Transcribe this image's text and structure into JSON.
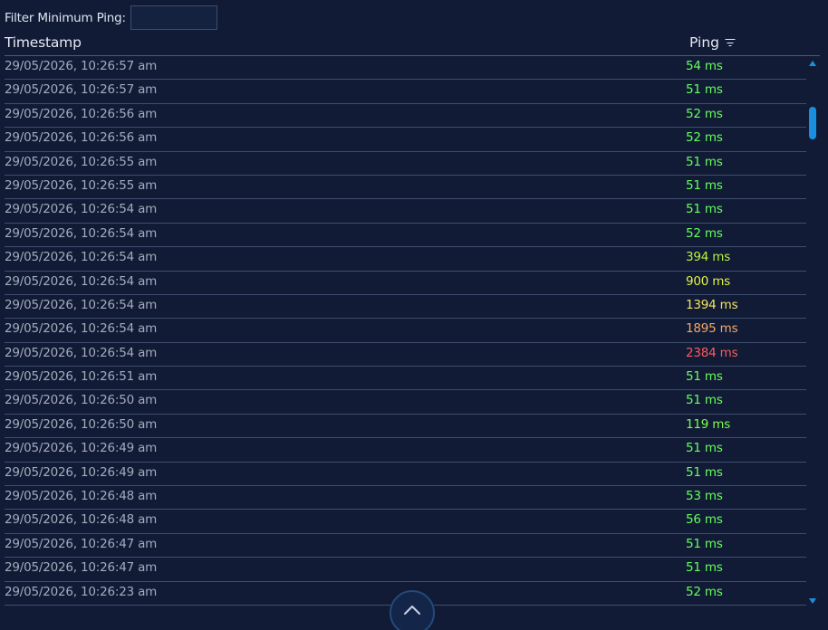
{
  "filter": {
    "label": "Filter Minimum Ping:",
    "value": "",
    "placeholder": ""
  },
  "table": {
    "columns": {
      "timestamp": "Timestamp",
      "ping": "Ping"
    },
    "rows": [
      {
        "timestamp": "29/05/2026, 10:26:57 am",
        "ping": "54 ms",
        "color": "#66ff5c"
      },
      {
        "timestamp": "29/05/2026, 10:26:57 am",
        "ping": "51 ms",
        "color": "#66ff5c"
      },
      {
        "timestamp": "29/05/2026, 10:26:56 am",
        "ping": "52 ms",
        "color": "#66ff5c"
      },
      {
        "timestamp": "29/05/2026, 10:26:56 am",
        "ping": "52 ms",
        "color": "#66ff5c"
      },
      {
        "timestamp": "29/05/2026, 10:26:55 am",
        "ping": "51 ms",
        "color": "#66ff5c"
      },
      {
        "timestamp": "29/05/2026, 10:26:55 am",
        "ping": "51 ms",
        "color": "#66ff5c"
      },
      {
        "timestamp": "29/05/2026, 10:26:54 am",
        "ping": "51 ms",
        "color": "#66ff5c"
      },
      {
        "timestamp": "29/05/2026, 10:26:54 am",
        "ping": "52 ms",
        "color": "#66ff5c"
      },
      {
        "timestamp": "29/05/2026, 10:26:54 am",
        "ping": "394 ms",
        "color": "#b6f53f"
      },
      {
        "timestamp": "29/05/2026, 10:26:54 am",
        "ping": "900 ms",
        "color": "#e3f249"
      },
      {
        "timestamp": "29/05/2026, 10:26:54 am",
        "ping": "1394 ms",
        "color": "#f5e45a"
      },
      {
        "timestamp": "29/05/2026, 10:26:54 am",
        "ping": "1895 ms",
        "color": "#f7a868"
      },
      {
        "timestamp": "29/05/2026, 10:26:54 am",
        "ping": "2384 ms",
        "color": "#ff5a5a"
      },
      {
        "timestamp": "29/05/2026, 10:26:51 am",
        "ping": "51 ms",
        "color": "#66ff5c"
      },
      {
        "timestamp": "29/05/2026, 10:26:50 am",
        "ping": "51 ms",
        "color": "#66ff5c"
      },
      {
        "timestamp": "29/05/2026, 10:26:50 am",
        "ping": "119 ms",
        "color": "#7dff4a"
      },
      {
        "timestamp": "29/05/2026, 10:26:49 am",
        "ping": "51 ms",
        "color": "#66ff5c"
      },
      {
        "timestamp": "29/05/2026, 10:26:49 am",
        "ping": "51 ms",
        "color": "#66ff5c"
      },
      {
        "timestamp": "29/05/2026, 10:26:48 am",
        "ping": "53 ms",
        "color": "#66ff5c"
      },
      {
        "timestamp": "29/05/2026, 10:26:48 am",
        "ping": "56 ms",
        "color": "#66ff5c"
      },
      {
        "timestamp": "29/05/2026, 10:26:47 am",
        "ping": "51 ms",
        "color": "#66ff5c"
      },
      {
        "timestamp": "29/05/2026, 10:26:47 am",
        "ping": "51 ms",
        "color": "#66ff5c"
      },
      {
        "timestamp": "29/05/2026, 10:26:23 am",
        "ping": "52 ms",
        "color": "#66ff5c"
      }
    ]
  },
  "icons": {
    "sort": "filter-sort-icon",
    "scroll_up": "triangle-up-icon",
    "scroll_down": "triangle-down-icon",
    "back_to_top": "chevron-up-icon"
  },
  "colors": {
    "background": "#111b36",
    "accent": "#1a8fe0"
  }
}
